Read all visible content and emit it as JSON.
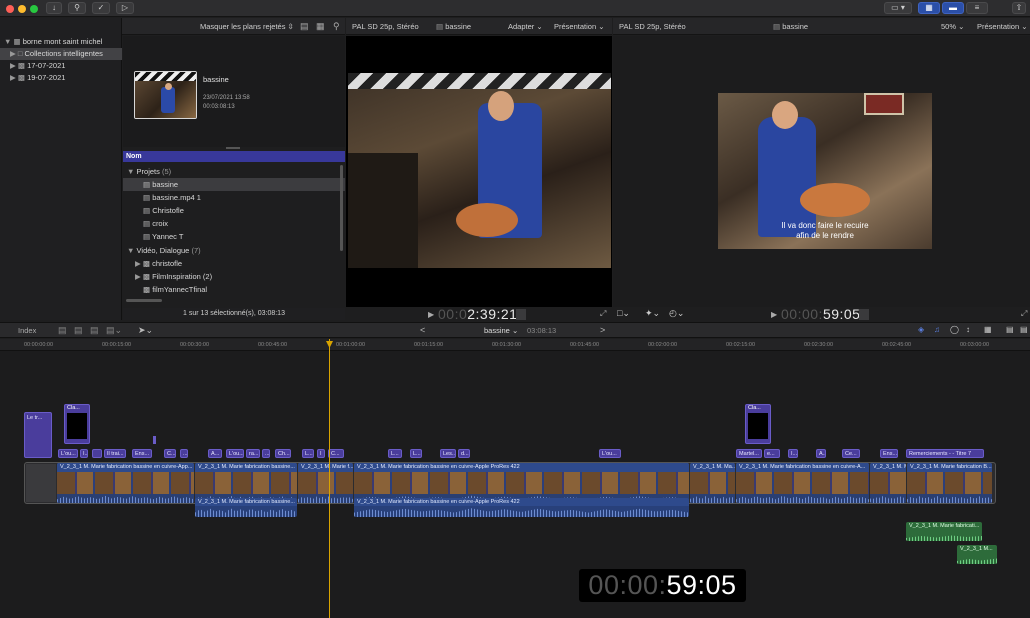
{
  "library": {
    "name": "borne mont saint michel",
    "items": [
      {
        "label": "Collections intelligentes",
        "selected": true
      },
      {
        "label": "17-07-2021",
        "selected": false
      },
      {
        "label": "19-07-2021",
        "selected": false
      }
    ]
  },
  "browser": {
    "filter": "Masquer les plans rejetés",
    "clip": {
      "name": "bassine",
      "date": "23/07/2021 13:58",
      "duration": "00:03:08:13"
    },
    "column_header": "Nom",
    "groups": [
      {
        "label": "Projets",
        "count": "(5)",
        "items": [
          "bassine",
          "bassine.mp4 1",
          "Christofle",
          "croix",
          "Yannec T"
        ]
      },
      {
        "label": "Vidéo, Dialogue",
        "count": "(7)",
        "items": [
          "christofle",
          "FilmInspiration (2)",
          "filmYannecTfinal"
        ]
      }
    ],
    "status": "1 sur 13 sélectionné(s), 03:08:13"
  },
  "viewer_event": {
    "format": "PAL SD 25p, Stéréo",
    "clip_name": "bassine",
    "fit": "Adapter",
    "view": "Présentation",
    "timecode_dim": "00:0",
    "timecode": "2:39:21"
  },
  "viewer_project": {
    "format": "PAL SD 25p, Stéréo",
    "clip_name": "bassine",
    "zoom": "50%",
    "view": "Présentation",
    "subtitle_line1": "Il va donc faire le recuire",
    "subtitle_line2": "afin de le rendre",
    "timecode_dim": "00:00:",
    "timecode": "59:05"
  },
  "timeline": {
    "index_label": "Index",
    "project_name": "bassine",
    "project_duration": "03:08:13",
    "ruler": [
      "00:00:00:00",
      "00:00:15:00",
      "00:00:30:00",
      "00:00:45:00",
      "00:01:00:00",
      "00:01:15:00",
      "00:01:30:00",
      "00:01:45:00",
      "00:02:00:00",
      "00:02:15:00",
      "00:02:30:00",
      "00:02:45:00",
      "00:03:00:00"
    ],
    "title_clip": "Le tr...",
    "connected": [
      "Cla...",
      "Cla..."
    ],
    "captions": [
      "L'ou...",
      "I...",
      "Il trai...",
      "Ens...",
      "C...",
      "...",
      "A...",
      "L'ou...",
      "ra...",
      "...",
      "Ch...",
      "L...",
      "I",
      "C...",
      "L...",
      "L...",
      "Les...",
      "d...",
      "L'ou...",
      "Martel...",
      "e...",
      "I...",
      "A...",
      "Ce...",
      "Ens...",
      "Remerciements - - Titre 7"
    ],
    "primary_clips": [
      "V_2_3_1 M. Marie fabrication bassine en cuivre-App...",
      "V_2_3_1 M. Marie fabrication bassine...",
      "V_2_3_1 M. Marie f...",
      "V_2_3_1 M. Marie fabrication bassine en cuivre-Apple ProRes 422",
      "V_2_3_1 M. Ma...",
      "V_2_3_1 M. Marie fabrication bassine en cuivre-A...",
      "V_2_3_1 M. Ma...",
      "V_2_3_1 M. Marie fabrication B..."
    ],
    "secondary_audio": [
      "V_2_3_1 M. Marie fabrication bassine...",
      "V_2_3_1 M. Marie fabrication bassine en cuivre-Apple ProRes 422"
    ],
    "music_clips": [
      "V_2_3_1 M. Marie fabricati...",
      "V_2_3_1 M..."
    ],
    "big_timecode_dim": "00:00:",
    "big_timecode": "59:05"
  }
}
